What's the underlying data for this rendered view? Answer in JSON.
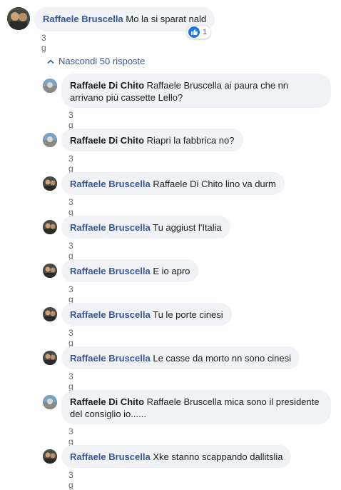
{
  "root": {
    "author": "Raffaele Bruscella",
    "text": "Mo la si sparat nald",
    "time": "3 g",
    "reaction_count": "1"
  },
  "toggle_label": "Nascondi 50 risposte",
  "replies": [
    {
      "author": "Raffaele Di Chito",
      "text": "Raffaele Bruscella ai paura che nn arrivano più cassette Lello?",
      "time": "3 g"
    },
    {
      "author": "Raffaele Di Chito",
      "text": "Riapri la fabbrica no?",
      "time": "3 g"
    },
    {
      "author": "Raffaele Bruscella",
      "text": "Raffaele Di Chito lino va durm",
      "time": "3 g"
    },
    {
      "author": "Raffaele Bruscella",
      "text": "Tu aggiust l'Italia",
      "time": "3 g"
    },
    {
      "author": "Raffaele Bruscella",
      "text": "E io apro",
      "time": "3 g"
    },
    {
      "author": "Raffaele Bruscella",
      "text": "Tu le porte cinesi",
      "time": "3 g"
    },
    {
      "author": "Raffaele Bruscella",
      "text": "Le casse da morto nn sono cinesi",
      "time": "3 g"
    },
    {
      "author": "Raffaele Di Chito",
      "text": "Raffaele Bruscella mica sono il presidente del consiglio io......",
      "time": "3 g"
    },
    {
      "author": "Raffaele Bruscella",
      "text": "Xke stanno scappando dallitslia",
      "time": "3 g"
    }
  ]
}
